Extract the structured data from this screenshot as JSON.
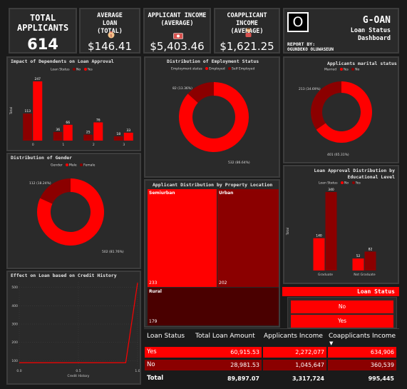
{
  "kpis": {
    "total_applicants": {
      "title": "TOTAL APPLICANTS",
      "value": "614"
    },
    "average_loan": {
      "title": "AVERAGE LOAN (TOTAL)",
      "value": "$146.41"
    },
    "applicant_income": {
      "title": "APPLICANT INCOME (AVERAGE)",
      "value": "$5,403.46"
    },
    "coapplicant_income": {
      "title": "COAPPLICANT INCOME (AVERAGE)",
      "value": "$1,621.25"
    }
  },
  "brand": {
    "logo_letter": "O",
    "name": "G-OAN",
    "subtitle_line1": "Loan Status",
    "subtitle_line2": "Dashboard",
    "report_by_label": "REPORT BY:",
    "author": "OGUNDEKO OLUWASEUN"
  },
  "colors": {
    "red": "#ff0000",
    "dark_red": "#8b0000",
    "bg": "#1a1a1a",
    "panel": "#2a2a2a"
  },
  "icons": [
    "money-bag-icon",
    "cash-icon",
    "person-icon"
  ],
  "chart_data": [
    {
      "id": "dependents",
      "type": "bar",
      "title": "Impact of Dependents on Loan Approval",
      "legend_title": "Loan Status",
      "legend": [
        "No",
        "Yes"
      ],
      "ylabel": "Total",
      "categories": [
        "0",
        "1",
        "2",
        "3"
      ],
      "series": [
        {
          "name": "No",
          "values": [
            113,
            36,
            25,
            18
          ]
        },
        {
          "name": "Yes",
          "values": [
            247,
            66,
            76,
            33
          ]
        }
      ],
      "ylim": [
        0,
        250
      ]
    },
    {
      "id": "employment",
      "type": "pie",
      "title": "Distribution of Employment Status",
      "legend_title": "Employment status",
      "legend": [
        "Employed",
        "Self Employed"
      ],
      "values": [
        532,
        82
      ],
      "labels": [
        "532 (86.64%)",
        "82 (13.36%)"
      ]
    },
    {
      "id": "marital",
      "type": "pie",
      "title": "Applicants marital status",
      "legend_title": "Married",
      "legend": [
        "Yes",
        "No"
      ],
      "values": [
        401,
        213
      ],
      "labels": [
        "401 (65.31%)",
        "213 (34.69%)"
      ]
    },
    {
      "id": "gender",
      "type": "pie",
      "title": "Distribution of Gender",
      "legend_title": "Gender",
      "legend": [
        "Male",
        "Female"
      ],
      "values": [
        502,
        112
      ],
      "labels": [
        "502 (81.76%)",
        "112 (18.24%)"
      ]
    },
    {
      "id": "property",
      "type": "treemap",
      "title": "Applicant Distribution by Property Location",
      "categories": [
        "Semiurban",
        "Urban",
        "Rural"
      ],
      "values": [
        233,
        202,
        179
      ]
    },
    {
      "id": "education",
      "type": "bar",
      "title": "Loan Approval Distribution by Educational Level",
      "legend_title": "Loan Status",
      "legend": [
        "No",
        "Yes"
      ],
      "ylabel": "Total",
      "categories": [
        "Graduate",
        "Not Graduate"
      ],
      "series": [
        {
          "name": "No",
          "values": [
            140,
            52
          ]
        },
        {
          "name": "Yes",
          "values": [
            340,
            82
          ]
        }
      ],
      "ylim": [
        0,
        340
      ]
    },
    {
      "id": "credit",
      "type": "line",
      "title": "Effect on Loan based on Credit History",
      "xlabel": "Credit History",
      "x": [
        0.0,
        0.9,
        1.0
      ],
      "y": [
        89,
        89,
        525
      ],
      "xticks": [
        "0.0",
        "0.5",
        "1.0"
      ],
      "yticks": [
        "100",
        "200",
        "300",
        "400",
        "500"
      ],
      "xlim": [
        0,
        1
      ],
      "ylim": [
        70,
        530
      ]
    }
  ],
  "slicer": {
    "title": "Loan Status",
    "options": [
      "No",
      "Yes"
    ]
  },
  "table": {
    "headers": [
      "Loan Status",
      "Total Loan Amount",
      "Applicants Income",
      "Coapplicants Income"
    ],
    "rows": [
      [
        "Yes",
        "60,915.53",
        "2,272,077",
        "634,906"
      ],
      [
        "No",
        "28,981.53",
        "1,045,647",
        "360,539"
      ]
    ],
    "total": [
      "Total",
      "89,897.07",
      "3,317,724",
      "995,445"
    ],
    "sort_indicator": "▼"
  }
}
